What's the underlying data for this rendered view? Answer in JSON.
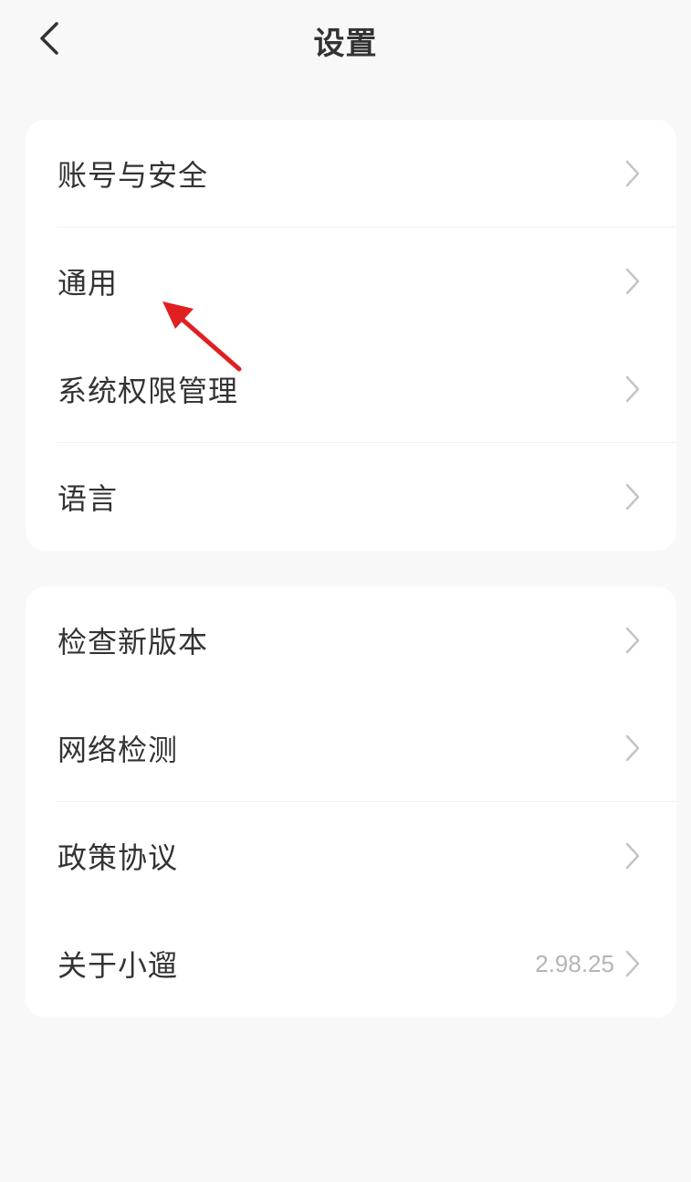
{
  "header": {
    "title": "设置",
    "back_icon": "chevron-left-icon"
  },
  "group1": {
    "items": [
      {
        "label": "账号与安全",
        "icon": "chevron-right-icon"
      },
      {
        "label": "通用",
        "icon": "chevron-right-icon"
      },
      {
        "label": "系统权限管理",
        "icon": "chevron-right-icon"
      },
      {
        "label": "语言",
        "icon": "chevron-right-icon"
      }
    ]
  },
  "group2": {
    "items": [
      {
        "label": "检查新版本",
        "icon": "chevron-right-icon"
      },
      {
        "label": "网络检测",
        "icon": "chevron-right-icon"
      },
      {
        "label": "政策协议",
        "icon": "chevron-right-icon"
      },
      {
        "label": "关于小遛",
        "value": "2.98.25",
        "icon": "chevron-right-icon"
      }
    ]
  },
  "annotation": {
    "icon": "red-arrow-icon",
    "color": "#e02020"
  },
  "colors": {
    "background": "#f8f8f8",
    "card": "#ffffff",
    "text": "#333333",
    "secondary_text": "#b5b5b5",
    "chevron": "#c4c4c4"
  }
}
